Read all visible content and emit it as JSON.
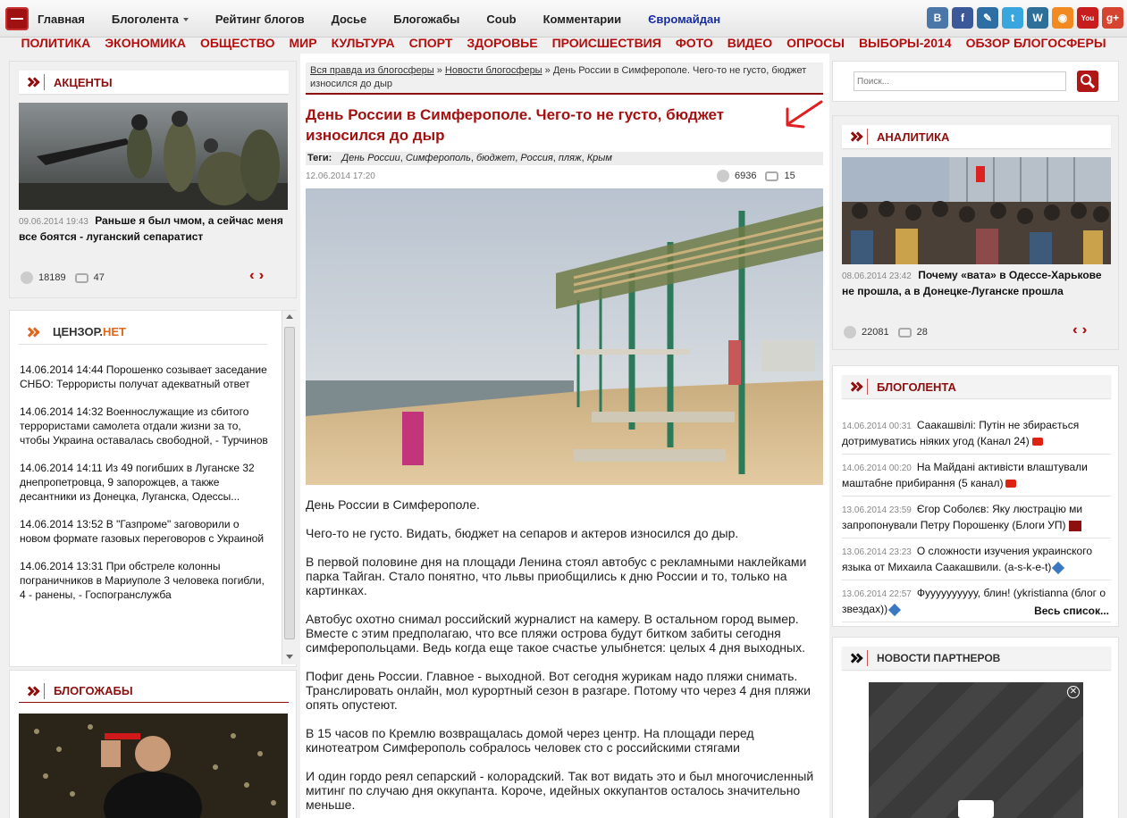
{
  "topnav": [
    {
      "label": "Главная"
    },
    {
      "label": "Блоголента",
      "dropdown": true
    },
    {
      "label": "Рейтинг блогов"
    },
    {
      "label": "Досье"
    },
    {
      "label": "Блогожабы"
    },
    {
      "label": "Coub"
    },
    {
      "label": "Комментарии"
    },
    {
      "label": "Євромайдан",
      "highlight": true
    }
  ],
  "social": [
    {
      "icon": "vk-icon",
      "glyph": "B",
      "color": "#4a76a8"
    },
    {
      "icon": "facebook-icon",
      "glyph": "f",
      "color": "#3b5998"
    },
    {
      "icon": "livejournal-icon",
      "glyph": "✎",
      "color": "#2d6ea5"
    },
    {
      "icon": "twitter-icon",
      "glyph": "t",
      "color": "#3aa6de"
    },
    {
      "icon": "wordpress-icon",
      "glyph": "W",
      "color": "#2e6f9a"
    },
    {
      "icon": "rss-icon",
      "glyph": "◉",
      "color": "#f18b21"
    },
    {
      "icon": "youtube-icon",
      "glyph": "You",
      "color": "#c81d1d"
    },
    {
      "icon": "googleplus-icon",
      "glyph": "g+",
      "color": "#d6432e"
    }
  ],
  "categories": [
    "ПОЛИТИКА",
    "ЭКОНОМИКА",
    "ОБЩЕСТВО",
    "МИР",
    "КУЛЬТУРА",
    "СПОРТ",
    "ЗДОРОВЬЕ",
    "ПРОИСШЕСТВИЯ",
    "ФОТО",
    "ВИДЕО",
    "ОПРОСЫ",
    "ВЫБОРЫ-2014",
    "ОБЗОР БЛОГОСФЕРЫ"
  ],
  "accents": {
    "title": "АКЦЕНТЫ",
    "date": "09.06.2014 19:43",
    "headline": "Раньше я был чмом, а сейчас меня все боятся - луганский сепаратист",
    "views": "18189",
    "comments": "47"
  },
  "censor": {
    "title_a": "ЦЕНЗОР.",
    "title_b": "НЕТ",
    "items": [
      "14.06.2014 14:44 Порошенко созывает заседание СНБО: Террористы получат адекватный ответ",
      "14.06.2014 14:32 Военнослужащие из сбитого террористами самолета отдали жизни за то, чтобы Украина оставалась свободной, - Турчинов",
      "14.06.2014 14:11 Из 49 погибших в Луганске 32 днепропетровца, 9 запорожцев, а также десантники из Донецка, Луганска, Одессы...",
      "14.06.2014 13:52 В \"Газпроме\" заговорили о новом формате газовых переговоров с Украиной",
      "14.06.2014 13:31 При обстреле колонны пограничников в Мариуполе 3 человека погибли, 4 - ранены, - Госпогранслужба"
    ]
  },
  "blogozhaby": {
    "title": "БЛОГОЖАБЫ"
  },
  "article": {
    "crumb1": "Вся правда из блогосферы",
    "crumb2": "Новости блогосферы",
    "crumb_sep": "»",
    "crumb3": "День России в Симферополе. Чего-то не густо, бюджет износился до дыр",
    "title": "День России в Симферополе. Чего-то не густо, бюджет износился до дыр",
    "tags_label": "Теги:",
    "tags": [
      "День России",
      "Симферополь",
      "бюджет",
      "Россия",
      "пляж",
      "Крым"
    ],
    "date": "12.06.2014 17:20",
    "views": "6936",
    "comments": "15",
    "paragraphs": [
      "День России в Симферополе.",
      "Чего-то не густо. Видать, бюджет на сепаров и актеров износился до дыр.",
      "В первой половине дня на площади Ленина стоял автобус с рекламными наклейками парка Тайган. Стало понятно, что львы приобщились к дню России и то, только на картинках.",
      "Автобус охотно снимал российский журналист на камеру. В остальном город вымер. Вместе с этим предполагаю, что все пляжи острова будут битком забиты сегодня симферопольцами. Ведь когда еще такое счастье улыбнется: целых 4 дня выходных.",
      "Пофиг день России. Главное - выходной. Вот сегодня журикам надо пляжи снимать. Транслировать онлайн, мол курортный сезон в разгаре. Потому что через 4 дня пляжи опять опустеют.",
      "В 15 часов по Кремлю возвращалась домой через центр. На площади перед кинотеатром Симферополь собралось человек сто с российскими стягами",
      "И один гордо реял сепарский - колорадский. Так вот видать это и был многочисленный митинг по случаю дня оккупанта. Короче, идейных оккупантов осталось значительно меньше."
    ]
  },
  "search": {
    "placeholder": "Поиск..."
  },
  "analytics": {
    "title": "АНАЛИТИКА",
    "date": "08.06.2014 23:42",
    "headline": "Почему «вата» в Одессе-Харькове не прошла, а в Донецке-Луганске прошла",
    "views": "22081",
    "comments": "28"
  },
  "blogolenta": {
    "title": "БЛОГОЛЕНТА",
    "items": [
      {
        "date": "14.06.2014 00:31",
        "text": "Саакашвілі: Путін не збирається дотримуватись ніяких угод (Канал 24)",
        "badge": "yt"
      },
      {
        "date": "14.06.2014 00:20",
        "text": "На Майдані активісти влаштували маштабне прибирання (5 канал)",
        "badge": "yt"
      },
      {
        "date": "13.06.2014 23:59",
        "text": "Єгор Соболєв: Яку люстрацію ми запропонували Петру Порошенку (Блоги УП)",
        "badge": "up"
      },
      {
        "date": "13.06.2014 23:23",
        "text": "О сложности изучения украинского языка от Михаила Саакашвили. (a-s-k-e-t)",
        "badge": "lj"
      },
      {
        "date": "13.06.2014 22:57",
        "text": "Фуууууууууу, блин! (ykristianna (блог о звездах))",
        "badge": "lj"
      }
    ],
    "all_link": "Весь список..."
  },
  "partners": {
    "title": "НОВОСТИ ПАРТНЕРОВ"
  }
}
